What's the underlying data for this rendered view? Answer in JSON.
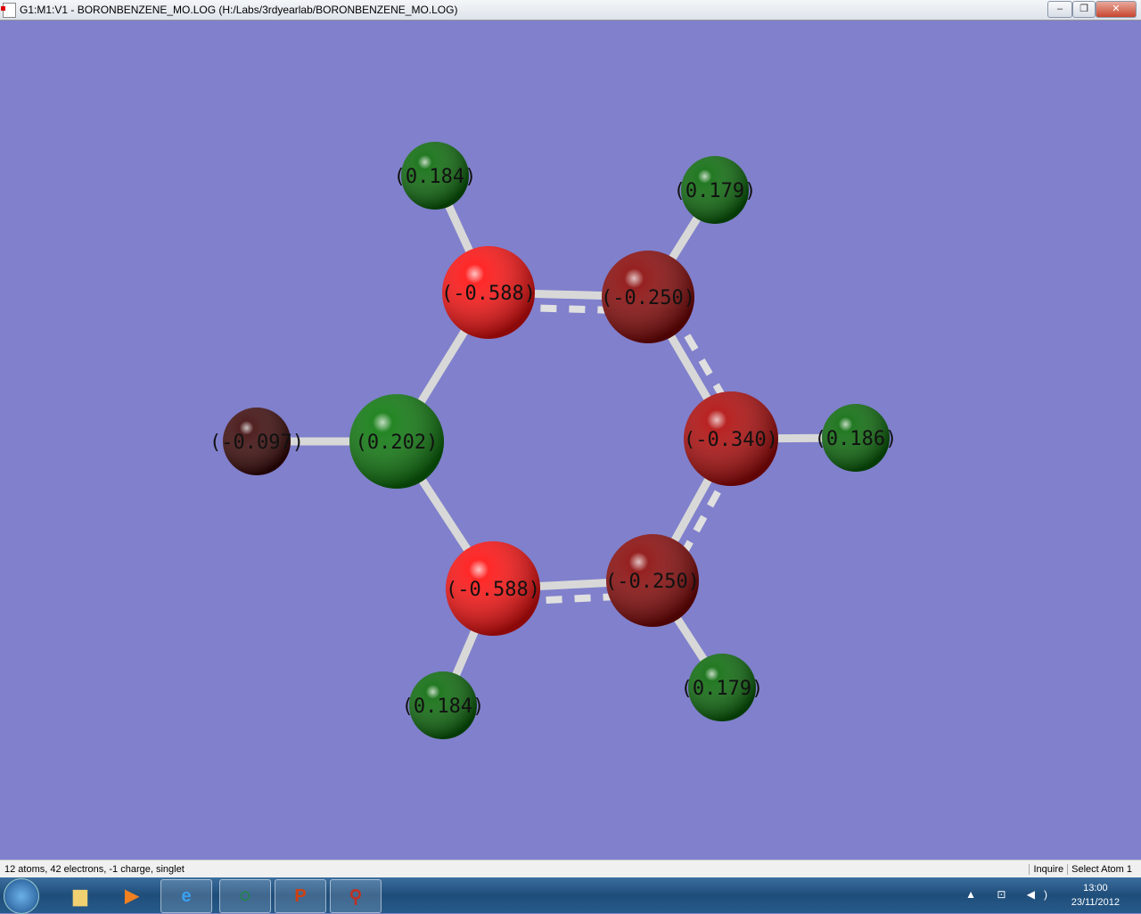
{
  "window": {
    "title": "G1:M1:V1 - BORONBENZENE_MO.LOG (H:/Labs/3rdyearlab/BORONBENZENE_MO.LOG)",
    "minimize": "–",
    "restore": "❐",
    "close": "✕"
  },
  "atoms": [
    {
      "element": "H",
      "charge": "(0.184)",
      "color": "#0a6a0a"
    },
    {
      "element": "H",
      "charge": "(0.179)",
      "color": "#0a6a0a"
    },
    {
      "element": "C",
      "charge": "(-0.588)",
      "color": "#ff1010"
    },
    {
      "element": "C",
      "charge": "(-0.250)",
      "color": "#8a0808"
    },
    {
      "element": "C",
      "charge": "(-0.340)",
      "color": "#b00a0a"
    },
    {
      "element": "H",
      "charge": "(0.186)",
      "color": "#0a6a0a"
    },
    {
      "element": "B",
      "charge": "(0.202)",
      "color": "#0c780c"
    },
    {
      "element": "H",
      "charge": "(-0.097)",
      "color": "#3c0808"
    },
    {
      "element": "C",
      "charge": "(-0.588)",
      "color": "#ff1010"
    },
    {
      "element": "C",
      "charge": "(-0.250)",
      "color": "#8a0808"
    },
    {
      "element": "H",
      "charge": "(0.184)",
      "color": "#0a6a0a"
    },
    {
      "element": "H",
      "charge": "(0.179)",
      "color": "#0a6a0a"
    }
  ],
  "status": {
    "info": "12 atoms, 42 electrons, -1 charge, singlet",
    "mode": "Inquire",
    "action": "Select Atom 1"
  },
  "taskbar": {
    "apps": [
      "explorer",
      "media-player",
      "internet-explorer",
      "chemdraw",
      "powerpoint",
      "gaussview"
    ],
    "time": "13:00",
    "date": "23/11/2012",
    "tray": "▲ ⊡ ◀)"
  }
}
